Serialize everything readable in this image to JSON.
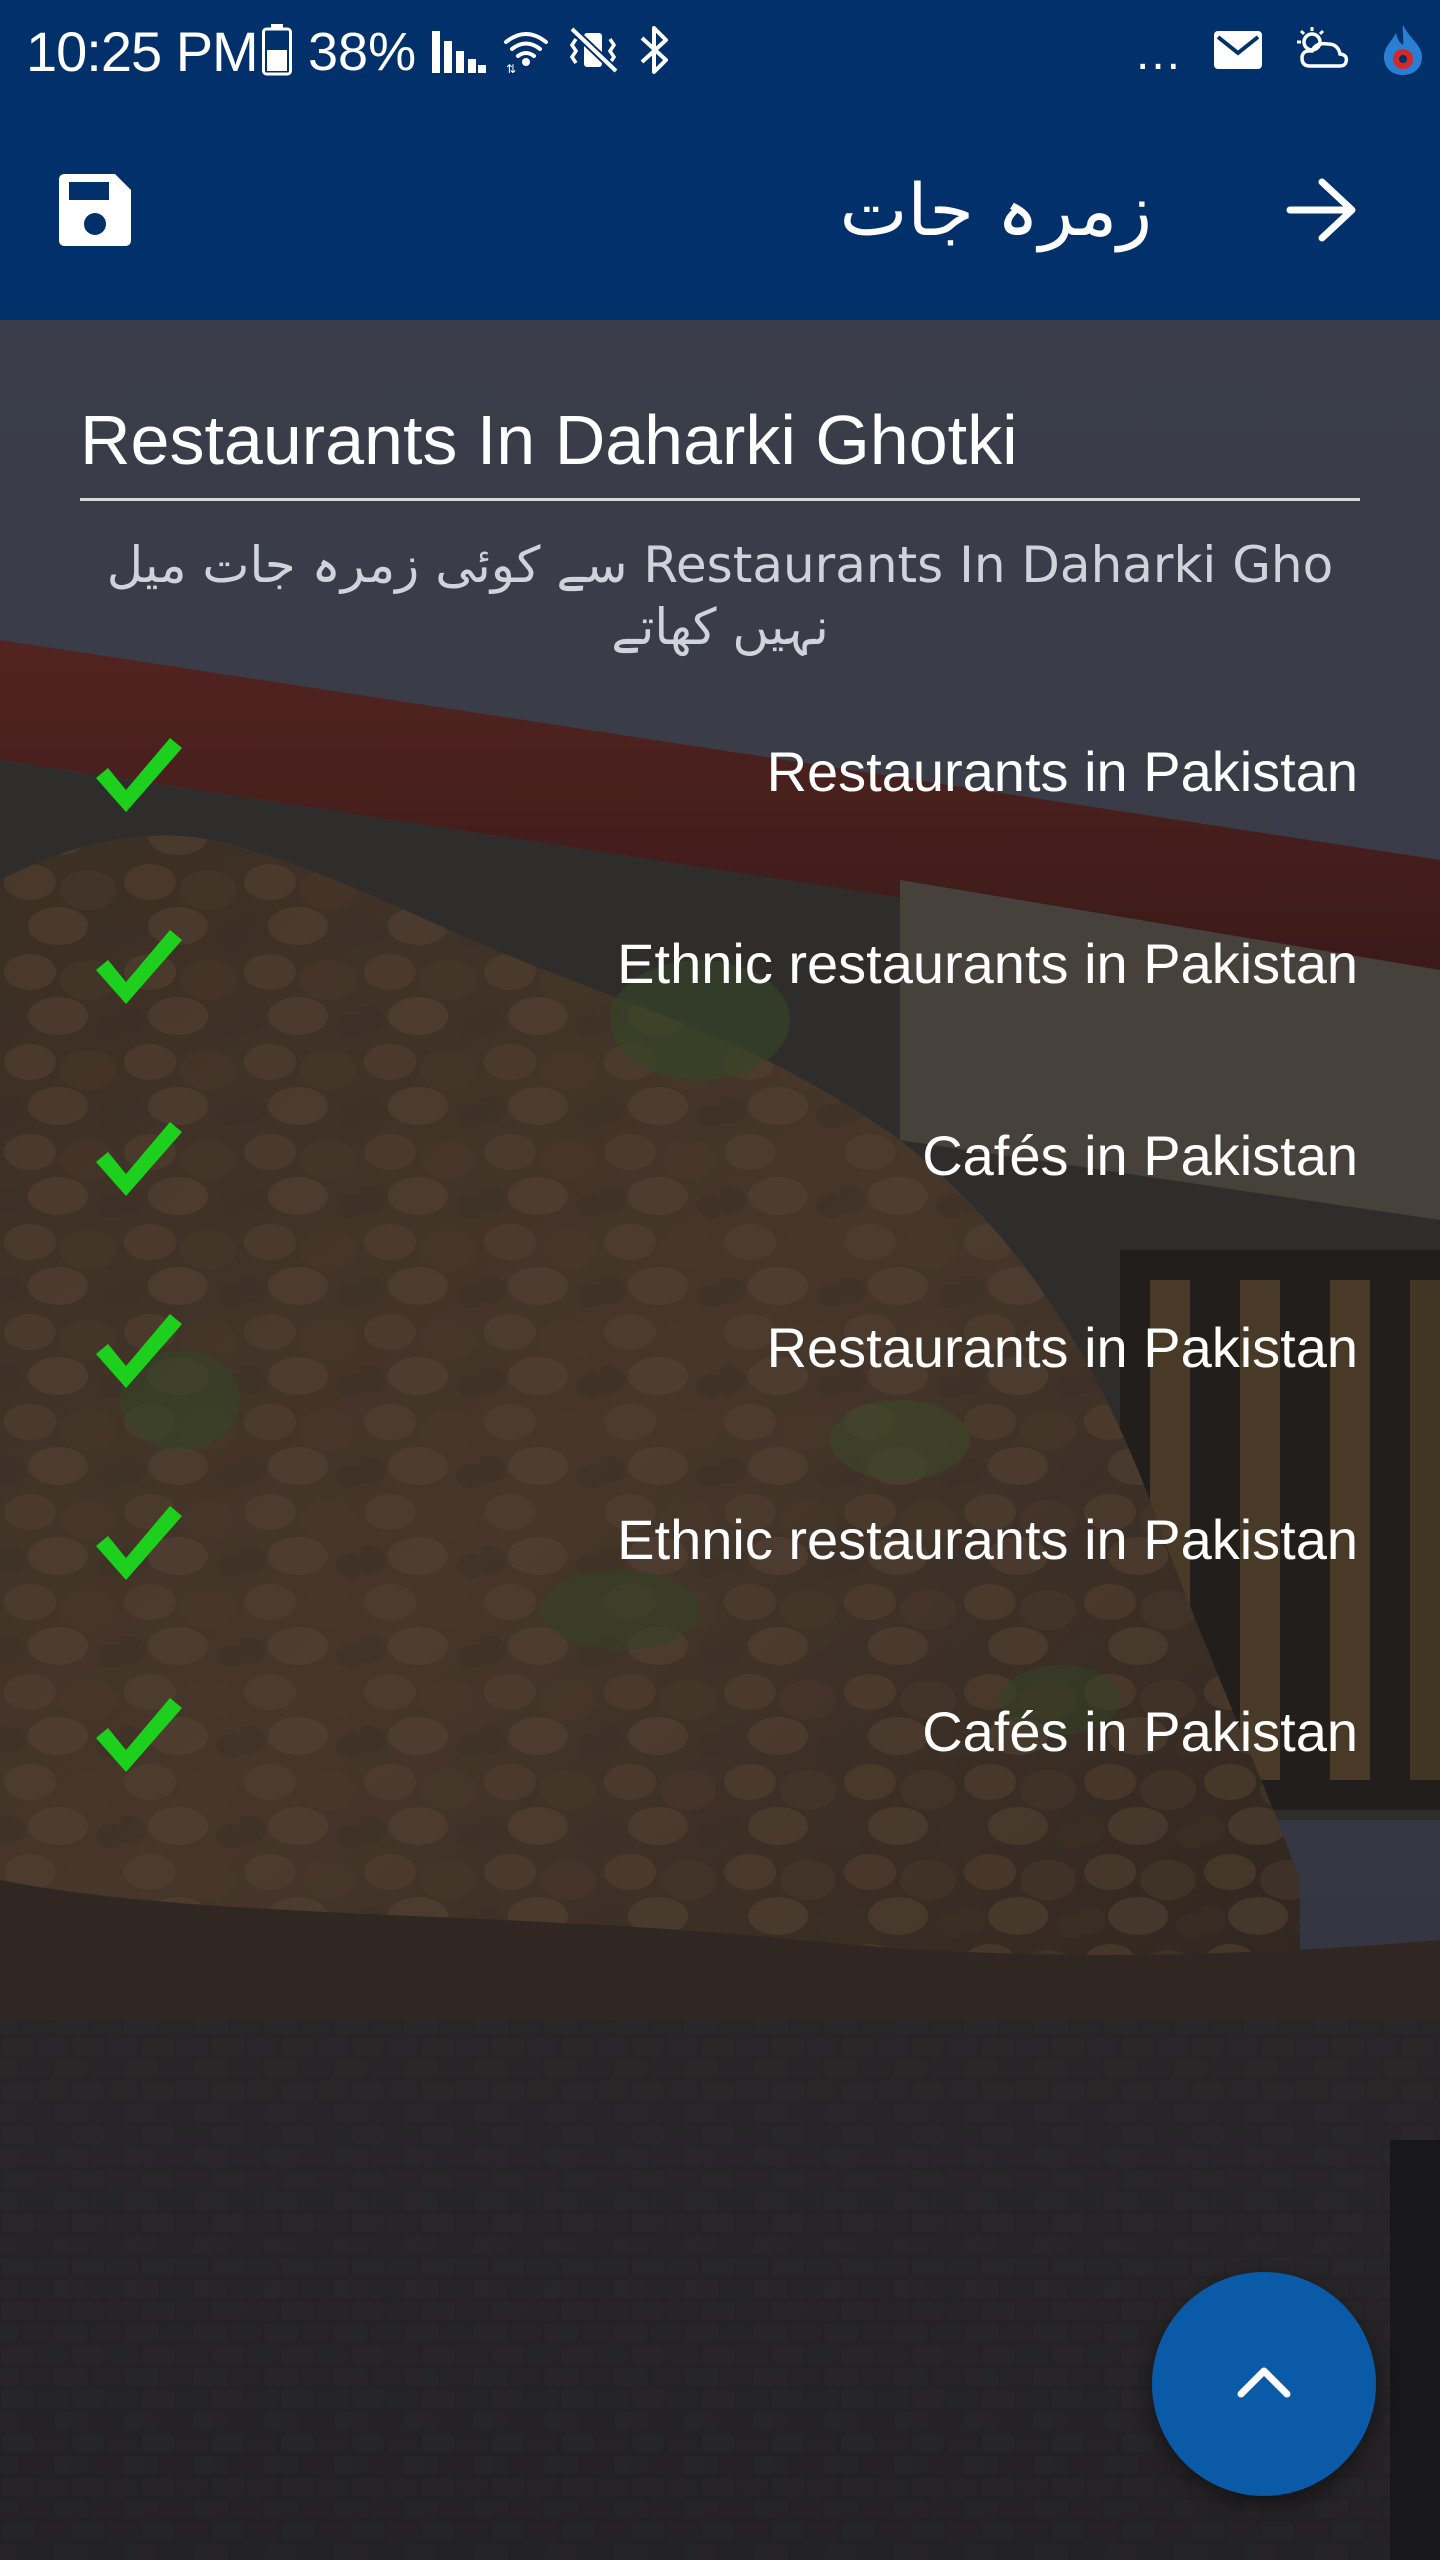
{
  "status_bar": {
    "time": "10:25 PM",
    "battery_percent": "38%",
    "more_indicator": "...",
    "icons": [
      "battery-icon",
      "signal-icon",
      "wifi-icon",
      "vibrate-off-icon",
      "bluetooth-icon",
      "mail-icon",
      "weather-icon",
      "app-notification-icon"
    ]
  },
  "app_bar": {
    "title": "زمرہ جات",
    "save_icon": "save-icon",
    "forward_icon": "arrow-right-icon",
    "color": "#01306a"
  },
  "search": {
    "value": "Restaurants In Daharki Ghotki",
    "message": "Restaurants In Daharki Gho سے کوئی زمرہ جات میل نہیں کھاتے"
  },
  "categories": [
    {
      "label": "Restaurants in Pakistan",
      "checked": true
    },
    {
      "label": "Ethnic restaurants in Pakistan",
      "checked": true
    },
    {
      "label": "Cafés in Pakistan",
      "checked": true
    },
    {
      "label": "Restaurants in Pakistan",
      "checked": true
    },
    {
      "label": "Ethnic restaurants in Pakistan",
      "checked": true
    },
    {
      "label": "Cafés in Pakistan",
      "checked": true
    }
  ],
  "fab": {
    "icon": "chevron-up-icon",
    "color": "#0a5aa8"
  },
  "colors": {
    "check": "#1ed01e",
    "divider": "#d9d9d9"
  }
}
